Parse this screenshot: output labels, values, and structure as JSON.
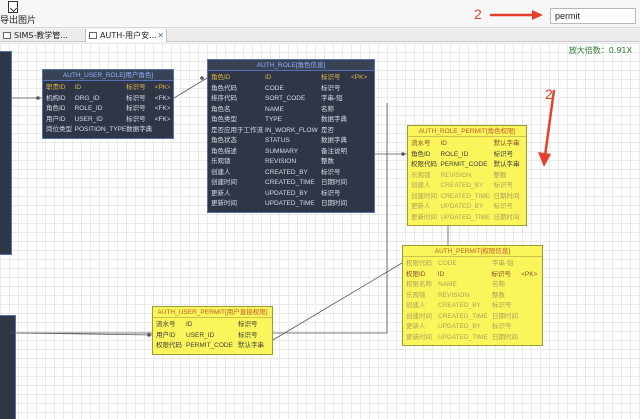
{
  "toolbar": {
    "export_label": "导出图片"
  },
  "annotation_top": "2",
  "annotation_right": "2",
  "search": {
    "value": "permit"
  },
  "tabs": [
    {
      "label": "SIMS-教学管..."
    },
    {
      "label": "AUTH-用户安...",
      "close": "✕"
    }
  ],
  "zoom_label": "放大倍数：0.91X",
  "tables": {
    "auth_user_role": {
      "title": "AUTH_USER_ROLE[用户角色]",
      "rows": [
        [
          "职责ID",
          "ID",
          "标识号",
          "<PK>"
        ],
        [
          "机构ID",
          "ORG_ID",
          "标识号",
          "<FK>"
        ],
        [
          "角色ID",
          "ROLE_ID",
          "标识号",
          "<FK>"
        ],
        [
          "用户ID",
          "USER_ID",
          "标识号",
          "<FK>"
        ],
        [
          "岗位类型",
          "POSITION_TYPE",
          "数据字典",
          ""
        ]
      ]
    },
    "auth_role": {
      "title": "AUTH_ROLE[角色信息]",
      "rows": [
        [
          "角色ID",
          "ID",
          "标识号",
          "<PK>"
        ],
        [
          "角色代码",
          "CODE",
          "标识号",
          ""
        ],
        [
          "排序代码",
          "SORT_CODE",
          "字串-短",
          ""
        ],
        [
          "角色名",
          "NAME",
          "名称",
          ""
        ],
        [
          "角色类型",
          "TYPE",
          "数据字典",
          ""
        ],
        [
          "是否应用于工作流",
          "IN_WORK_FLOW",
          "是否",
          ""
        ],
        [
          "角色状态",
          "STATUS",
          "数据字典",
          ""
        ],
        [
          "角色描述",
          "SUMMARY",
          "备注说明",
          ""
        ],
        [
          "乐观锁",
          "REVISION",
          "整数",
          ""
        ],
        [
          "创建人",
          "CREATED_BY",
          "标识号",
          ""
        ],
        [
          "创建时间",
          "CREATED_TIME",
          "日期时间",
          ""
        ],
        [
          "更新人",
          "UPDATED_BY",
          "标识号",
          ""
        ],
        [
          "更新时间",
          "UPDATED_TIME",
          "日期时间",
          ""
        ]
      ]
    },
    "auth_role_permit": {
      "title": "AUTH_ROLE_PERMIT[角色权限]",
      "rows": [
        [
          "流水号",
          "ID",
          "默认字串",
          ""
        ],
        [
          "角色ID",
          "ROLE_ID",
          "标识号",
          ""
        ],
        [
          "权限代码",
          "PERMIT_CODE",
          "默认字串",
          ""
        ],
        [
          "乐观锁",
          "REVISION",
          "整数",
          ""
        ],
        [
          "创建人",
          "CREATED_BY",
          "标识号",
          ""
        ],
        [
          "创建时间",
          "CREATED_TIME",
          "日期时间",
          ""
        ],
        [
          "更新人",
          "UPDATED_BY",
          "标识号",
          ""
        ],
        [
          "更新时间",
          "UPDATED_TIME",
          "日期时间",
          ""
        ]
      ]
    },
    "auth_permit": {
      "title": "AUTH_PERMIT[权限信息]",
      "rows": [
        [
          "权限代码",
          "CODE",
          "字串-短",
          ""
        ],
        [
          "权限ID",
          "ID",
          "标识号",
          "<PK>"
        ],
        [
          "权限名称",
          "NAME",
          "名称",
          ""
        ],
        [
          "乐观锁",
          "REVISION",
          "整数",
          ""
        ],
        [
          "创建人",
          "CREATED_BY",
          "标识号",
          ""
        ],
        [
          "创建时间",
          "CREATED_TIME",
          "日期时间",
          ""
        ],
        [
          "更新人",
          "UPDATED_BY",
          "标识号",
          ""
        ],
        [
          "更新时间",
          "UPDATED_TIME",
          "日期时间",
          ""
        ]
      ]
    },
    "auth_user_permit": {
      "title": "AUTH_USER_PERMIT[用户直接权限]",
      "rows": [
        [
          "流水号",
          "ID",
          "标识号",
          ""
        ],
        [
          "用户ID",
          "USER_ID",
          "标识号",
          ""
        ],
        [
          "权限代码",
          "PERMIT_CODE",
          "默认字串",
          ""
        ]
      ]
    }
  }
}
